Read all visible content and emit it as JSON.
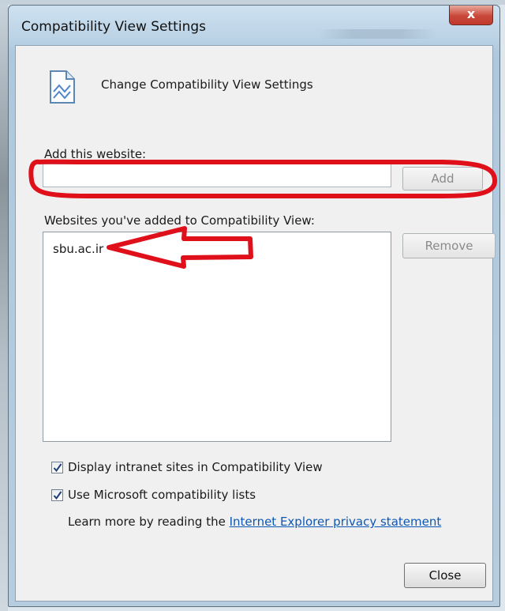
{
  "window": {
    "title": "Compatibility View Settings",
    "close_glyph": "x"
  },
  "header": {
    "icon": "document-icon",
    "text": "Change Compatibility View Settings"
  },
  "add_section": {
    "label": "Add this website:",
    "input_value": "",
    "add_button": "Add"
  },
  "list_section": {
    "label": "Websites you've added to Compatibility View:",
    "items": [
      "sbu.ac.ir"
    ],
    "remove_button": "Remove"
  },
  "options": {
    "intranet": {
      "label": "Display intranet sites in Compatibility View",
      "checked": true
    },
    "ms_lists": {
      "label": "Use Microsoft compatibility lists",
      "checked": true
    }
  },
  "learn_more": {
    "prefix": "Learn more by reading the",
    "link": "Internet Explorer privacy statement"
  },
  "footer": {
    "close_button": "Close"
  },
  "colors": {
    "annotation_red": "#e0101a",
    "link_blue": "#0d58b5"
  }
}
